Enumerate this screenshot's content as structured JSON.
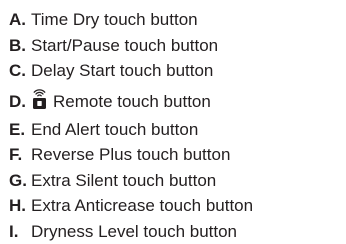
{
  "legend": {
    "items": [
      {
        "letter": "A.",
        "text": "Time Dry touch button"
      },
      {
        "letter": "B.",
        "text": "Start/Pause touch button"
      },
      {
        "letter": "C.",
        "text": "Delay Start touch button"
      },
      {
        "letter": "D.",
        "text": "Remote touch button",
        "icon": "remote-wifi-icon"
      },
      {
        "letter": "E.",
        "text": "End Alert touch button"
      },
      {
        "letter": "F.",
        "text": "Reverse Plus touch button"
      },
      {
        "letter": "G.",
        "text": "Extra Silent touch button"
      },
      {
        "letter": "H.",
        "text": "Extra Anticrease touch button"
      },
      {
        "letter": "I.",
        "text": "Dryness Level touch button"
      }
    ]
  }
}
